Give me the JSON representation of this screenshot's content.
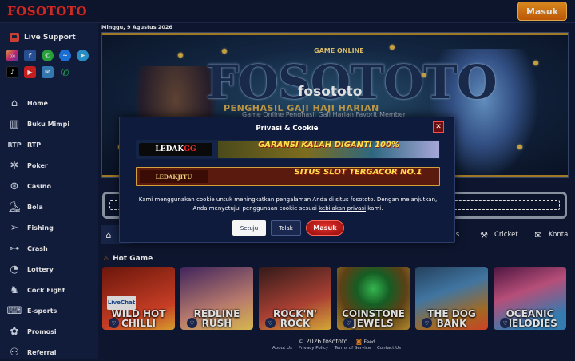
{
  "header": {
    "logo_text": "FOSOTOTO",
    "login_label": "Masuk"
  },
  "sidebar": {
    "live_support_label": "Live Support",
    "social_icons": [
      "instagram-icon",
      "facebook-icon",
      "whatsapp-icon",
      "messenger-icon",
      "telegram-icon",
      "tiktok-icon",
      "youtube-icon",
      "email-icon",
      "phone-icon"
    ],
    "items": [
      {
        "label": "Home",
        "icon": "home-icon"
      },
      {
        "label": "Buku Mimpi",
        "icon": "book-icon"
      },
      {
        "label": "RTP",
        "icon": "rtp-icon"
      },
      {
        "label": "Poker",
        "icon": "poker-chip-icon"
      },
      {
        "label": "Casino",
        "icon": "casino-icon"
      },
      {
        "label": "Bola",
        "icon": "shoe-icon"
      },
      {
        "label": "Fishing",
        "icon": "fish-icon"
      },
      {
        "label": "Crash",
        "icon": "gamepad-icon"
      },
      {
        "label": "Lottery",
        "icon": "lottery-icon"
      },
      {
        "label": "Cock Fight",
        "icon": "rooster-icon"
      },
      {
        "label": "E-sports",
        "icon": "esports-icon"
      },
      {
        "label": "Promosi",
        "icon": "promo-icon"
      },
      {
        "label": "Referral",
        "icon": "referral-icon"
      }
    ]
  },
  "main": {
    "date": "Minggu, 9 Agustus 2026",
    "banner": {
      "site_name": "fosototo",
      "brand": "FOSOTOTO",
      "tag": "GAME ONLINE",
      "sub1": "PENGHASIL GAJI HAJI HARIAN",
      "sub2": "Game Online Penghasil Gaji Harian Favorit Member"
    },
    "categories": [
      {
        "label": "H",
        "icon": "home-icon"
      },
      {
        "label": "nis",
        "icon": "tennis-icon"
      },
      {
        "label": "Cricket",
        "icon": "cricket-icon"
      },
      {
        "label": "Konta",
        "icon": "mail-icon"
      }
    ],
    "hot_game_label": "Hot Game",
    "games": [
      {
        "title": "WILD HOT CHILLI",
        "colors": [
          "#7a1a0e",
          "#e3472b"
        ]
      },
      {
        "title": "REDLINE RUSH",
        "colors": [
          "#4a2a6a",
          "#d08a7c"
        ]
      },
      {
        "title": "ROCK'N' ROCK",
        "colors": [
          "#3a1e1e",
          "#c24a3b"
        ]
      },
      {
        "title": "COINSTONE JEWELS",
        "colors": [
          "#1a3a2a",
          "#c89a33"
        ]
      },
      {
        "title": "THE DOG BANK",
        "colors": [
          "#2a4a6a",
          "#b8782a"
        ]
      },
      {
        "title": "OCEANIC MELODIES",
        "colors": [
          "#5a1a4a",
          "#3c8cc8"
        ]
      }
    ],
    "livechat_label": "LiveChat"
  },
  "footer": {
    "copyright": "© 2026  fosototo",
    "feed_label": "Feed",
    "links": [
      "About Us",
      "Privacy Policy",
      "Terms of Service",
      "Contact Us"
    ]
  },
  "modal": {
    "title": "Privasi & Cookie",
    "ad1_logo_prefix": "LEDAK",
    "ad1_logo_suffix": "GG",
    "ad1_text": "GARANSI KALAH DIGANTI 100%",
    "ad2_logo": "LEDAKJITU",
    "ad2_text": "SITUS SLOT TERGACOR NO.1",
    "body_1": "Kami menggunakan cookie untuk meningkatkan pengalaman Anda di situs fosototo. Dengan melanjutkan, Anda menyetujui penggunaan cookie sesuai ",
    "policy_link": "kebijakan privasi",
    "body_2": " kami.",
    "accept_label": "Setuju",
    "reject_label": "Tolak",
    "login_label": "Masuk"
  }
}
